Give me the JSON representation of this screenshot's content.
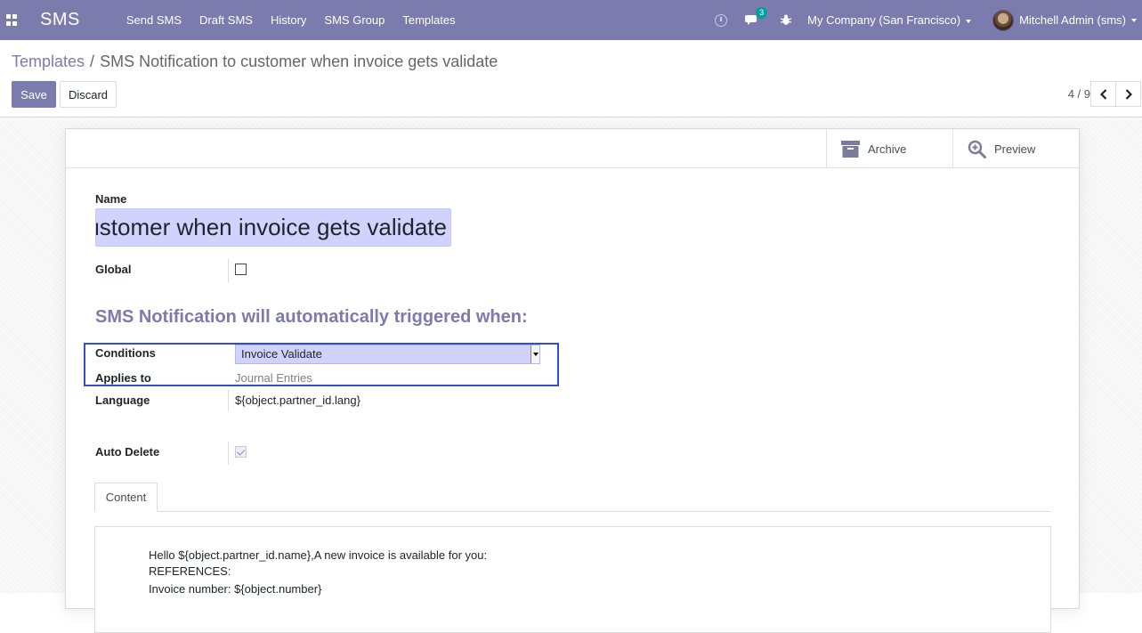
{
  "navbar": {
    "brand": "SMS",
    "menu": [
      "Send SMS",
      "Draft SMS",
      "History",
      "SMS Group",
      "Templates"
    ],
    "chat_badge": "3",
    "company": "My Company (San Francisco)",
    "user": "Mitchell Admin (sms)",
    "color": "#7c7bad"
  },
  "breadcrumb": {
    "parent": "Templates",
    "separator": "/",
    "current": "SMS Notification to customer when invoice gets validate"
  },
  "actions": {
    "save": "Save",
    "discard": "Discard"
  },
  "pager": {
    "value": "4 / 9"
  },
  "smart_buttons": {
    "archive": "Archive",
    "preview": "Preview"
  },
  "form": {
    "name_label": "Name",
    "name_value": "SMS Notification to customer when invoice gets validate",
    "global_label": "Global",
    "global_checked": false,
    "section_title": "SMS Notification will automatically triggered when:",
    "conditions_label": "Conditions",
    "conditions_value": "Invoice Validate",
    "applies_label": "Applies to",
    "applies_value": "Journal Entries",
    "language_label": "Language",
    "language_value": "${object.partner_id.lang}",
    "auto_delete_label": "Auto Delete",
    "auto_delete_checked": true
  },
  "tabs": {
    "content": "Content"
  },
  "content": {
    "lines": [
      "Hello ${object.partner_id.name},A new invoice is available for you:",
      "REFERENCES:",
      "Invoice number: ${object.number}"
    ]
  },
  "colors": {
    "accent": "#7c7bad",
    "input_bg": "#d2d2ff",
    "highlight": "#2d4fd0"
  }
}
